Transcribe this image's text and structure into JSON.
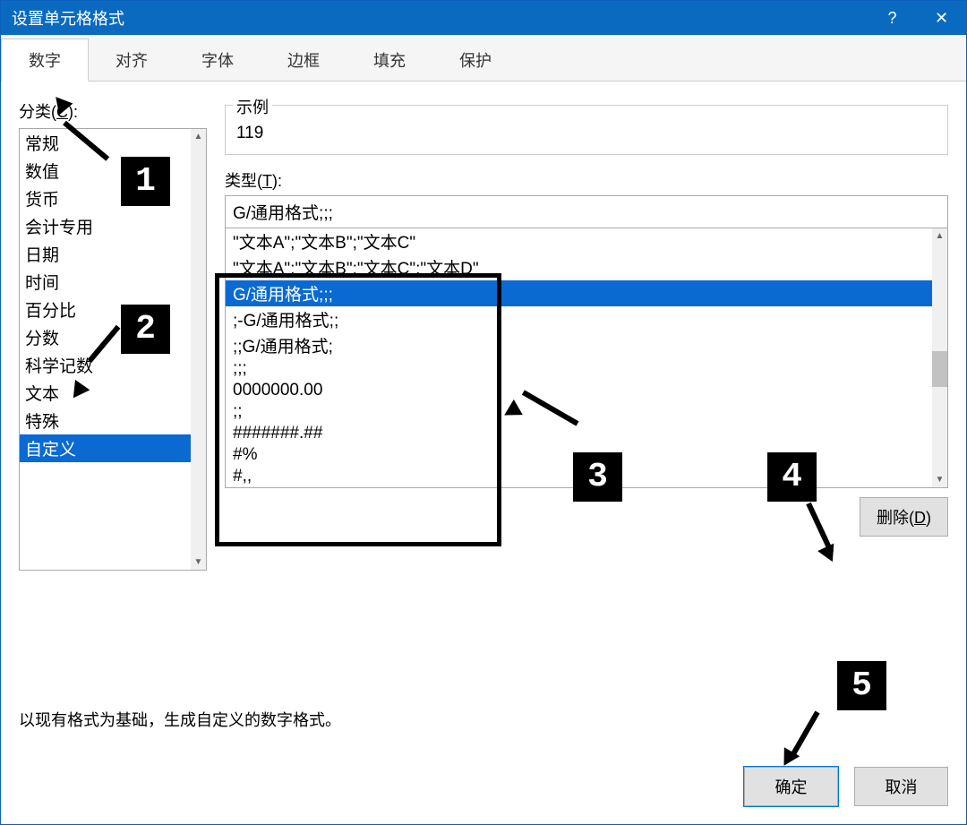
{
  "window": {
    "title": "设置单元格格式"
  },
  "titlebar_help": "?",
  "titlebar_close": "✕",
  "tabs": [
    "数字",
    "对齐",
    "字体",
    "边框",
    "填充",
    "保护"
  ],
  "active_tab": 0,
  "category_label_pre": "分类(",
  "category_label_key": "C",
  "category_label_post": "):",
  "categories": [
    "常规",
    "数值",
    "货币",
    "会计专用",
    "日期",
    "时间",
    "百分比",
    "分数",
    "科学记数",
    "文本",
    "特殊",
    "自定义"
  ],
  "selected_category_index": 11,
  "sample_title": "示例",
  "sample_value": "119",
  "type_label_pre": "类型(",
  "type_label_key": "T",
  "type_label_post": "):",
  "type_input_value": "G/通用格式;;;",
  "type_items": [
    "\"文本A\";\"文本B\";\"文本C\"",
    "\"文本A\";\"文本B\";\"文本C\";\"文本D\"",
    "G/通用格式;;;",
    ";-G/通用格式;;",
    ";;G/通用格式;",
    ";;;",
    "0000000.00",
    ";;",
    "#######.##",
    "#%",
    "#,,"
  ],
  "selected_type_index": 2,
  "delete_label_pre": "删除(",
  "delete_label_key": "D",
  "delete_label_post": ")",
  "hint": "以现有格式为基础，生成自定义的数字格式。",
  "ok_label": "确定",
  "cancel_label": "取消",
  "markers": {
    "1": "1",
    "2": "2",
    "3": "3",
    "4": "4",
    "5": "5"
  }
}
